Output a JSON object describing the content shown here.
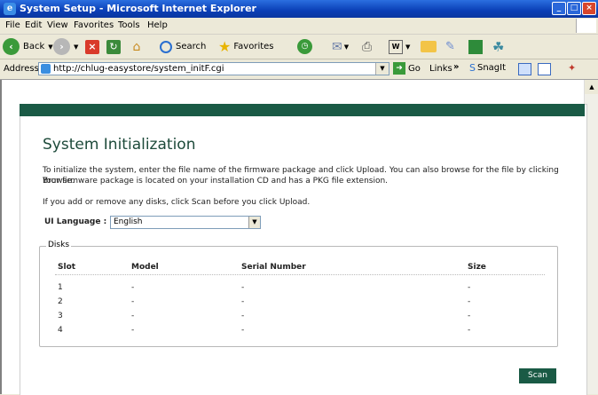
{
  "window": {
    "title": "System Setup - Microsoft Internet Explorer",
    "app_icon": "ie-icon"
  },
  "menu": [
    "File",
    "Edit",
    "View",
    "Favorites",
    "Tools",
    "Help"
  ],
  "toolbar": {
    "back": "Back",
    "search": "Search",
    "favorites": "Favorites"
  },
  "address": {
    "label": "Address",
    "url": "http://chlug-easystore/system_initF.cgi",
    "go": "Go",
    "links": "Links",
    "snagit": "SnagIt"
  },
  "page": {
    "heading": "System Initialization",
    "para1_line1": "To initialize the system, enter the file name of the firmware package and click Upload. You can also browse for the file by clicking Browse.",
    "para1_line2": "Your firmware package is located on your installation CD and has a PKG file extension.",
    "para2": "If you add or remove any disks, click Scan before you click Upload.",
    "language_label": "UI Language :",
    "language_value": "English",
    "disks_legend": "Disks",
    "columns": [
      "Slot",
      "Model",
      "Serial Number",
      "Size"
    ],
    "rows": [
      [
        "1",
        "-",
        "-",
        "-"
      ],
      [
        "2",
        "-",
        "-",
        "-"
      ],
      [
        "3",
        "-",
        "-",
        "-"
      ],
      [
        "4",
        "-",
        "-",
        "-"
      ]
    ],
    "scan_label": "Scan"
  },
  "colors": {
    "accent": "#1a5a45",
    "heading": "#1d4a3a"
  }
}
